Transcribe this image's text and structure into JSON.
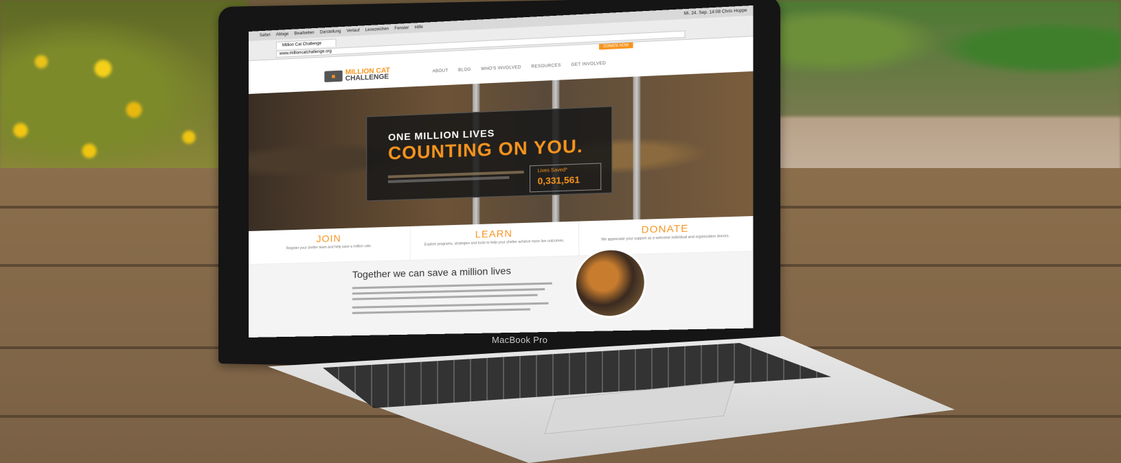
{
  "mac_menubar": {
    "apple": "",
    "items": [
      "Safari",
      "Ablage",
      "Bearbeiten",
      "Darstellung",
      "Verlauf",
      "Lesezeichen",
      "Fenster",
      "Hilfe"
    ],
    "status": "Mi. 24. Sep. 14:08  Chris Hoppe"
  },
  "browser": {
    "tab_title": "Million Cat Challenge",
    "url": "www.millioncatchallenge.org"
  },
  "site": {
    "donate_pill": "DONATE NOW",
    "logo": {
      "line1": "MILLION CAT",
      "line2": "CHALLENGE"
    },
    "nav": [
      "ABOUT",
      "BLOG",
      "WHO'S INVOLVED",
      "RESOURCES",
      "GET INVOLVED"
    ],
    "hero": {
      "line1": "ONE MILLION LIVES",
      "line2": "COUNTING ON YOU.",
      "lives_label": "Lives Saved*",
      "lives_count": "0,331,561"
    },
    "ctas": [
      {
        "title": "JOIN",
        "sub": "Register your shelter team and help save a million cats."
      },
      {
        "title": "LEARN",
        "sub": "Explore programs, strategies and tools to help your shelter achieve more live outcomes."
      },
      {
        "title": "DONATE",
        "sub": "We appreciate your support as a welcome individual and organization donors."
      }
    ],
    "about_heading": "Together we can save a million lives"
  },
  "laptop": {
    "label": "MacBook Pro"
  }
}
